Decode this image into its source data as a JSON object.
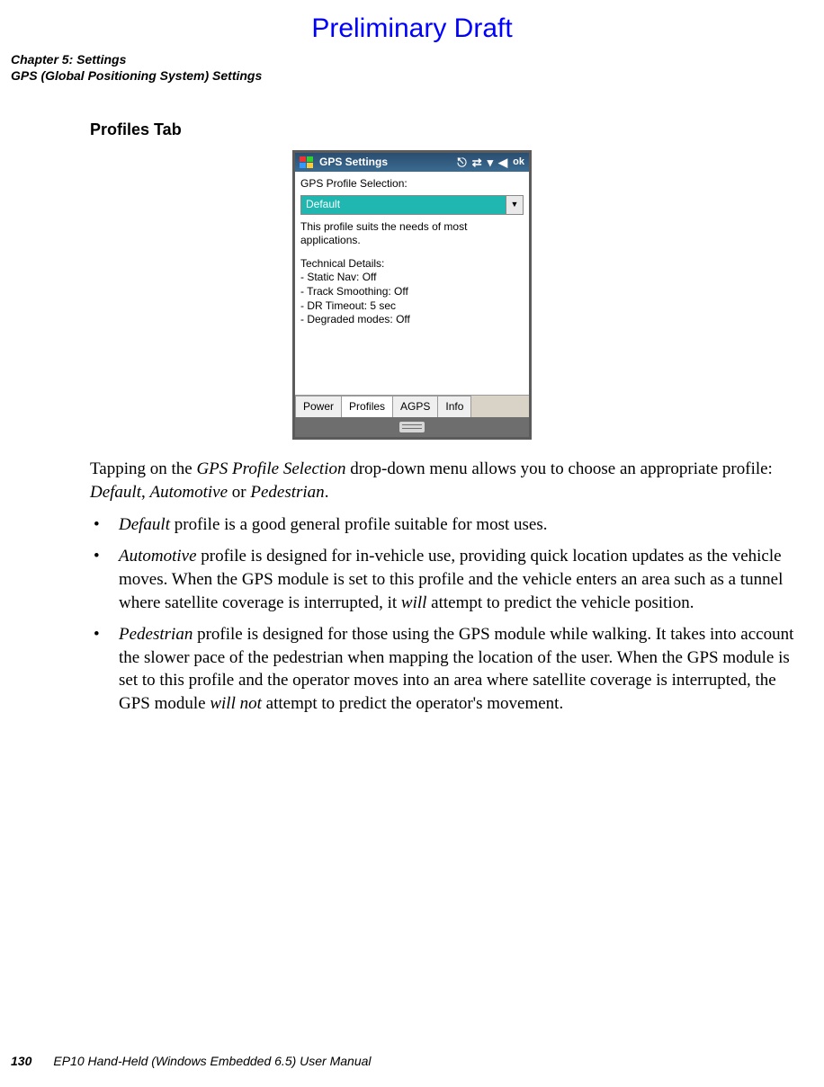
{
  "banner": "Preliminary Draft",
  "chapter_line": "Chapter 5: Settings",
  "section_line": "GPS (Global Positioning System) Settings",
  "section_title": "Profiles Tab",
  "device": {
    "title": "GPS Settings",
    "ok": "ok",
    "label": "GPS Profile Selection:",
    "dropdown_value": "Default",
    "description": "This profile suits the needs of most applications.",
    "tech_header": "Technical Details:",
    "tech": {
      "static_nav": "Static Nav: Off",
      "track_smoothing": "Track Smoothing: Off",
      "dr_timeout": "DR Timeout: 5 sec",
      "degraded": "Degraded modes: Off"
    },
    "tabs": {
      "power": "Power",
      "profiles": "Profiles",
      "agps": "AGPS",
      "info": "Info"
    }
  },
  "para_intro_1": "Tapping on the ",
  "para_intro_em1": "GPS Profile Selection",
  "para_intro_2": " drop-down menu allows you to choose an appropriate profile: ",
  "para_intro_em2": "Default",
  "para_intro_3": ", ",
  "para_intro_em3": "Automotive",
  "para_intro_4": " or ",
  "para_intro_em4": "Pedestrian",
  "para_intro_5": ".",
  "bullets": {
    "b1_em": "Default",
    "b1_text": " profile is a good general profile suitable for most uses.",
    "b2_em": "Automotive",
    "b2_text_a": " profile is designed for in-vehicle use, providing quick location updates as the vehicle moves. When the GPS module is set to this profile and the vehicle enters an area such as a tunnel where satellite coverage is interrupted, it ",
    "b2_will": "will",
    "b2_text_b": " attempt to predict the vehicle position.",
    "b3_em": "Pedestrian",
    "b3_text_a": " profile is designed for those using the GPS module while walking. It takes into account the slower pace of the pedestrian when mapping the location of the user. When the GPS module is set to this profile and the operator moves into an area where satellite coverage is interrupted, the GPS module ",
    "b3_willnot": "will not",
    "b3_text_b": " attempt to predict the opera­tor's movement."
  },
  "footer": {
    "page": "130",
    "doc": "EP10 Hand-Held (Windows Embedded 6.5) User Manual"
  }
}
